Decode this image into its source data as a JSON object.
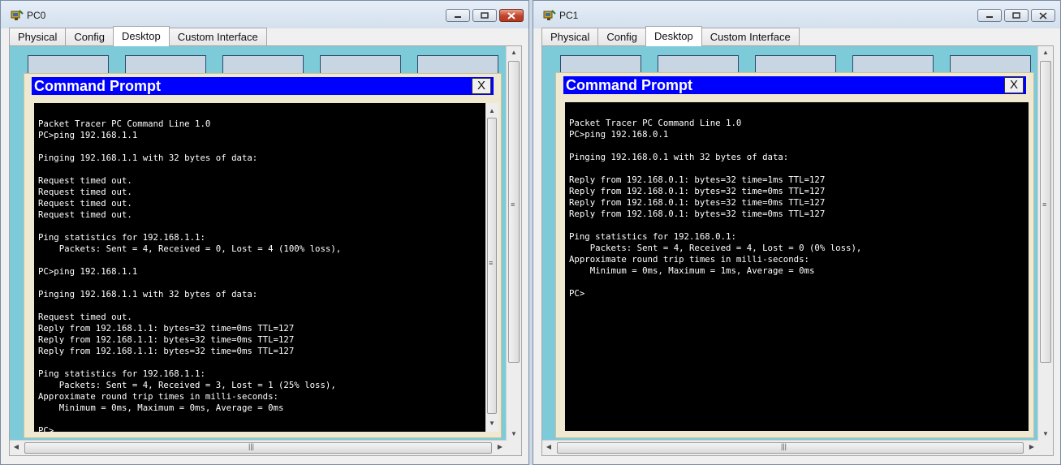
{
  "windows": [
    {
      "title": "PC0",
      "tabs": [
        "Physical",
        "Config",
        "Desktop",
        "Custom Interface"
      ],
      "active_tab": "Desktop",
      "cmd": {
        "title": "Command Prompt",
        "close_label": "X",
        "lines": [
          "",
          "Packet Tracer PC Command Line 1.0",
          "PC>ping 192.168.1.1",
          "",
          "Pinging 192.168.1.1 with 32 bytes of data:",
          "",
          "Request timed out.",
          "Request timed out.",
          "Request timed out.",
          "Request timed out.",
          "",
          "Ping statistics for 192.168.1.1:",
          "    Packets: Sent = 4, Received = 0, Lost = 4 (100% loss),",
          "",
          "PC>ping 192.168.1.1",
          "",
          "Pinging 192.168.1.1 with 32 bytes of data:",
          "",
          "Request timed out.",
          "Reply from 192.168.1.1: bytes=32 time=0ms TTL=127",
          "Reply from 192.168.1.1: bytes=32 time=0ms TTL=127",
          "Reply from 192.168.1.1: bytes=32 time=0ms TTL=127",
          "",
          "Ping statistics for 192.168.1.1:",
          "    Packets: Sent = 4, Received = 3, Lost = 1 (25% loss),",
          "Approximate round trip times in milli-seconds:",
          "    Minimum = 0ms, Maximum = 0ms, Average = 0ms",
          "",
          "PC>"
        ]
      }
    },
    {
      "title": "PC1",
      "tabs": [
        "Physical",
        "Config",
        "Desktop",
        "Custom Interface"
      ],
      "active_tab": "Desktop",
      "cmd": {
        "title": "Command Prompt",
        "close_label": "X",
        "lines": [
          "",
          "Packet Tracer PC Command Line 1.0",
          "PC>ping 192.168.0.1",
          "",
          "Pinging 192.168.0.1 with 32 bytes of data:",
          "",
          "Reply from 192.168.0.1: bytes=32 time=1ms TTL=127",
          "Reply from 192.168.0.1: bytes=32 time=0ms TTL=127",
          "Reply from 192.168.0.1: bytes=32 time=0ms TTL=127",
          "Reply from 192.168.0.1: bytes=32 time=0ms TTL=127",
          "",
          "Ping statistics for 192.168.0.1:",
          "    Packets: Sent = 4, Received = 4, Lost = 0 (0% loss),",
          "Approximate round trip times in milli-seconds:",
          "    Minimum = 0ms, Maximum = 1ms, Average = 0ms",
          "",
          "PC>"
        ]
      }
    }
  ],
  "colors": {
    "cmd_header": "#0000ff",
    "terminal_bg": "#000000",
    "terminal_fg": "#ffffff",
    "desktop_bg": "#7dcbd9"
  }
}
